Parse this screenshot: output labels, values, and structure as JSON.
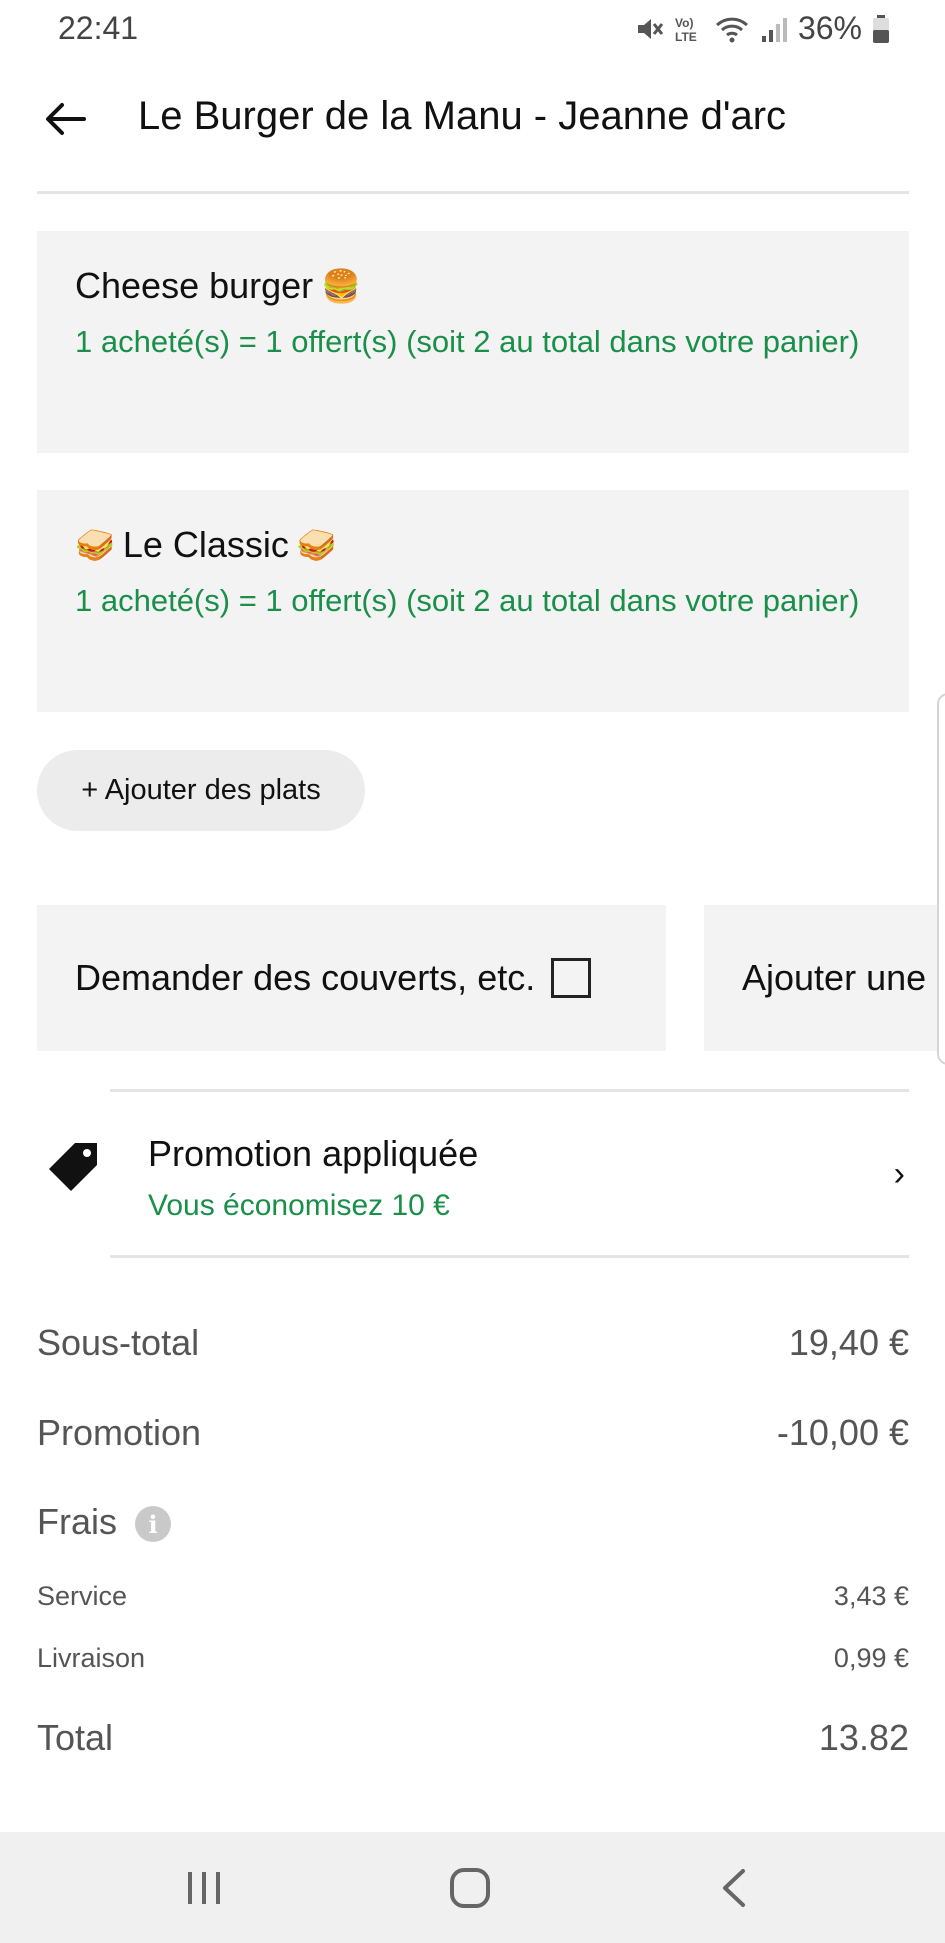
{
  "status_bar": {
    "time": "22:41",
    "battery_percent": "36%",
    "icons": [
      "mute-icon",
      "volte-icon",
      "wifi-icon",
      "signal-icon",
      "battery-icon"
    ]
  },
  "header": {
    "title": "Le Burger de la Manu - Jeanne d'arc",
    "back_icon": "arrow-left-icon"
  },
  "cart_items": [
    {
      "name": "Cheese burger",
      "emoji_after": "🍔",
      "promo": "1 acheté(s) = 1 offert(s) (soit 2 au total dans votre panier)"
    },
    {
      "name": "Le Classic",
      "emoji_before": "🥪",
      "emoji_after": "🥪",
      "promo": "1 acheté(s) = 1 offert(s) (soit 2 au total dans votre panier)"
    }
  ],
  "add_dishes_label": "+ Ajouter des plats",
  "options": {
    "cutlery_label": "Demander des couverts, etc.",
    "cutlery_checked": false,
    "note_label": "Ajouter une"
  },
  "promotion": {
    "title": "Promotion appliquée",
    "subtitle": "Vous économisez 10 €",
    "icon": "tag-icon",
    "chevron": "›"
  },
  "summary": {
    "subtotal_label": "Sous-total",
    "subtotal_value": "19,40 €",
    "promotion_label": "Promotion",
    "promotion_value": "-10,00 €",
    "fees_label": "Frais",
    "fees_info_icon": "i",
    "service_label": "Service",
    "service_value": "3,43 €",
    "delivery_label": "Livraison",
    "delivery_value": "0,99 €",
    "total_label": "Total",
    "total_value": "13.82"
  },
  "colors": {
    "promo_green": "#1a8f4a",
    "card_bg": "#f3f3f3",
    "nav_bg": "#f0f0f0"
  },
  "nav_bar": {
    "icons": [
      "recent-apps-icon",
      "home-icon",
      "back-icon"
    ]
  }
}
